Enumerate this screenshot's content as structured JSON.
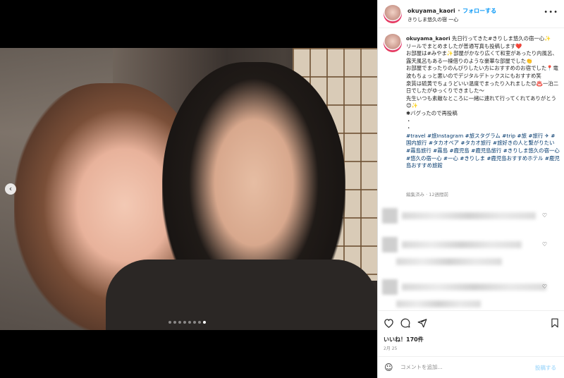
{
  "header": {
    "username": "okuyama_kaori",
    "separator": "•",
    "follow_label": "フォローする",
    "location": "きりしま悠久の宿 一心",
    "more_icon": "more-dots-icon"
  },
  "caption": {
    "username": "okuyama_kaori",
    "text": " 先日行ってきた#きりしま悠久の宿一心✨\nリールでまとめましたが普通写真も投稿します❤️\nお部屋は#みやま✨部屋がかなり広くて和室があったり内風呂、露天風呂もある一棟借りのような豪華な部屋でした👏\nお部屋でまったりのんびりしたい方におすすめのお宿でした📍電波もちょっと悪いのでデジタルデトックスにもおすすめ笑\n泉質は硫黄でちょうどいい温度でまったり入れました😊♨️一泊二日でしたがゆっくりできました〜\n先生いつも素敵なところに一緒に連れて行ってくれてありがとう😊✨\n✱バグったので再投稿\n・\n・",
    "hashtags": "#travel #旅Instagram #旅スタグラム #trip #旅 #旅行 ✈︎ #国内旅行 #タカオベア #タカオ旅行 #旅好きの人と繋がりたい #霧島旅行 #霧島 #鹿児島 #鹿児島旅行 #きりしま悠久の宿一心 #悠久の宿一心 #一心 #きりしま #鹿児島おすすめホテル #鹿児島おすすめ旅館",
    "meta": "編集済み · 12週間前"
  },
  "media": {
    "slide_count": 8,
    "active_slide": 8,
    "prev_icon": "chevron-left-icon"
  },
  "actions": {
    "like_icon": "heart-icon",
    "comment_icon": "comment-icon",
    "share_icon": "paper-plane-icon",
    "save_icon": "bookmark-icon"
  },
  "likes": "いいね！170件",
  "date": "2月 25",
  "comment_box": {
    "placeholder": "コメントを追加...",
    "post_label": "投稿する",
    "emoji_icon": "smiley-icon"
  },
  "colors": {
    "accent": "#0095f6",
    "link": "#00376b",
    "muted": "#8e8e8e"
  }
}
